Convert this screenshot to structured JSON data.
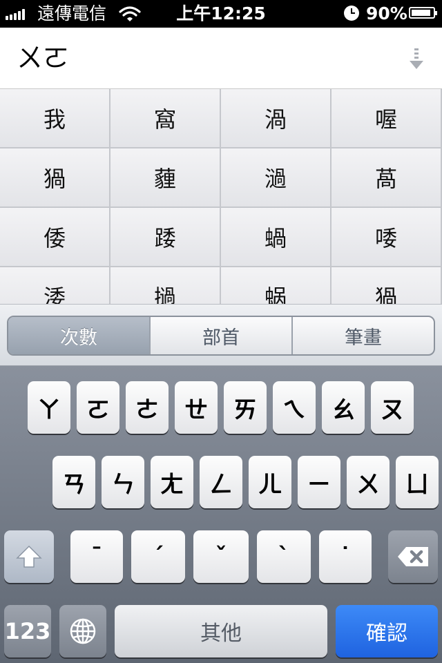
{
  "status_bar": {
    "carrier": "遠傳電信",
    "time": "上午12:25",
    "battery_percent": "90%",
    "battery_level": 0.9,
    "signal_bars": 5,
    "icons": [
      "signal-icon",
      "wifi-icon",
      "alarm-icon",
      "battery-icon"
    ]
  },
  "input": {
    "composing_text": "ㄨㄛ",
    "collapse_icon": "collapse-arrow-icon"
  },
  "candidates": [
    [
      "我",
      "窩",
      "渦",
      "喔"
    ],
    [
      "猧",
      "薶",
      "濄",
      "萵"
    ],
    [
      "倭",
      "踒",
      "蝸",
      "唩"
    ],
    [
      "涹",
      "撾",
      "蜗",
      "猧"
    ]
  ],
  "sort_options": {
    "items": [
      "次數",
      "部首",
      "筆畫"
    ],
    "selected_index": 0
  },
  "keyboard": {
    "row1": [
      "ㄚ",
      "ㄛ",
      "ㄜ",
      "ㄝ",
      "ㄞ",
      "ㄟ",
      "ㄠ",
      "ㄡ"
    ],
    "row2": [
      "ㄢ",
      "ㄣ",
      "ㄤ",
      "ㄥ",
      "ㄦ",
      "ㄧ",
      "ㄨ",
      "ㄩ"
    ],
    "tones": [
      "ˉ",
      "ˊ",
      "ˇ",
      "ˋ",
      "˙"
    ],
    "number_key": "123",
    "globe_icon": "globe-icon",
    "space_label": "其他",
    "confirm_label": "確認",
    "shift_icon": "shift-arrow-icon",
    "delete_icon": "backspace-icon"
  },
  "colors": {
    "confirm_key": "#1f63e0",
    "status_bar_bg": "#000000",
    "selected_segment": "#97a1ae"
  }
}
